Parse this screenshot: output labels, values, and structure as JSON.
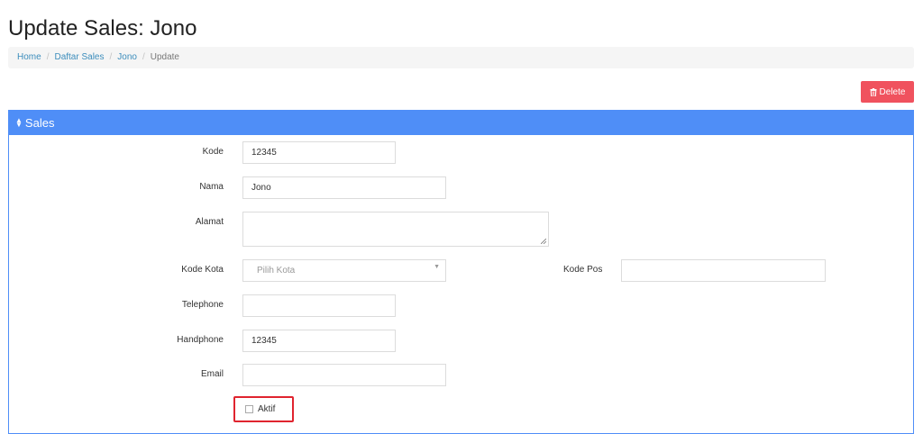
{
  "page": {
    "title": "Update Sales: Jono"
  },
  "breadcrumb": [
    {
      "label": "Home"
    },
    {
      "label": "Daftar Sales"
    },
    {
      "label": "Jono"
    },
    {
      "label": "Update"
    }
  ],
  "actions": {
    "delete_label": "Delete"
  },
  "panel": {
    "title": "Sales"
  },
  "form": {
    "kode": {
      "label": "Kode",
      "value": "12345"
    },
    "nama": {
      "label": "Nama",
      "value": "Jono"
    },
    "alamat": {
      "label": "Alamat",
      "value": ""
    },
    "kode_kota": {
      "label": "Kode Kota",
      "placeholder": "Pilih Kota"
    },
    "kode_pos": {
      "label": "Kode Pos",
      "value": ""
    },
    "telephone": {
      "label": "Telephone",
      "value": ""
    },
    "handphone": {
      "label": "Handphone",
      "value": "12345"
    },
    "email": {
      "label": "Email",
      "value": ""
    },
    "aktif": {
      "label": "Aktif",
      "checked": false
    }
  },
  "colors": {
    "accent": "#4f8ef7",
    "danger": "#f0525e",
    "highlight": "#e0242f"
  }
}
